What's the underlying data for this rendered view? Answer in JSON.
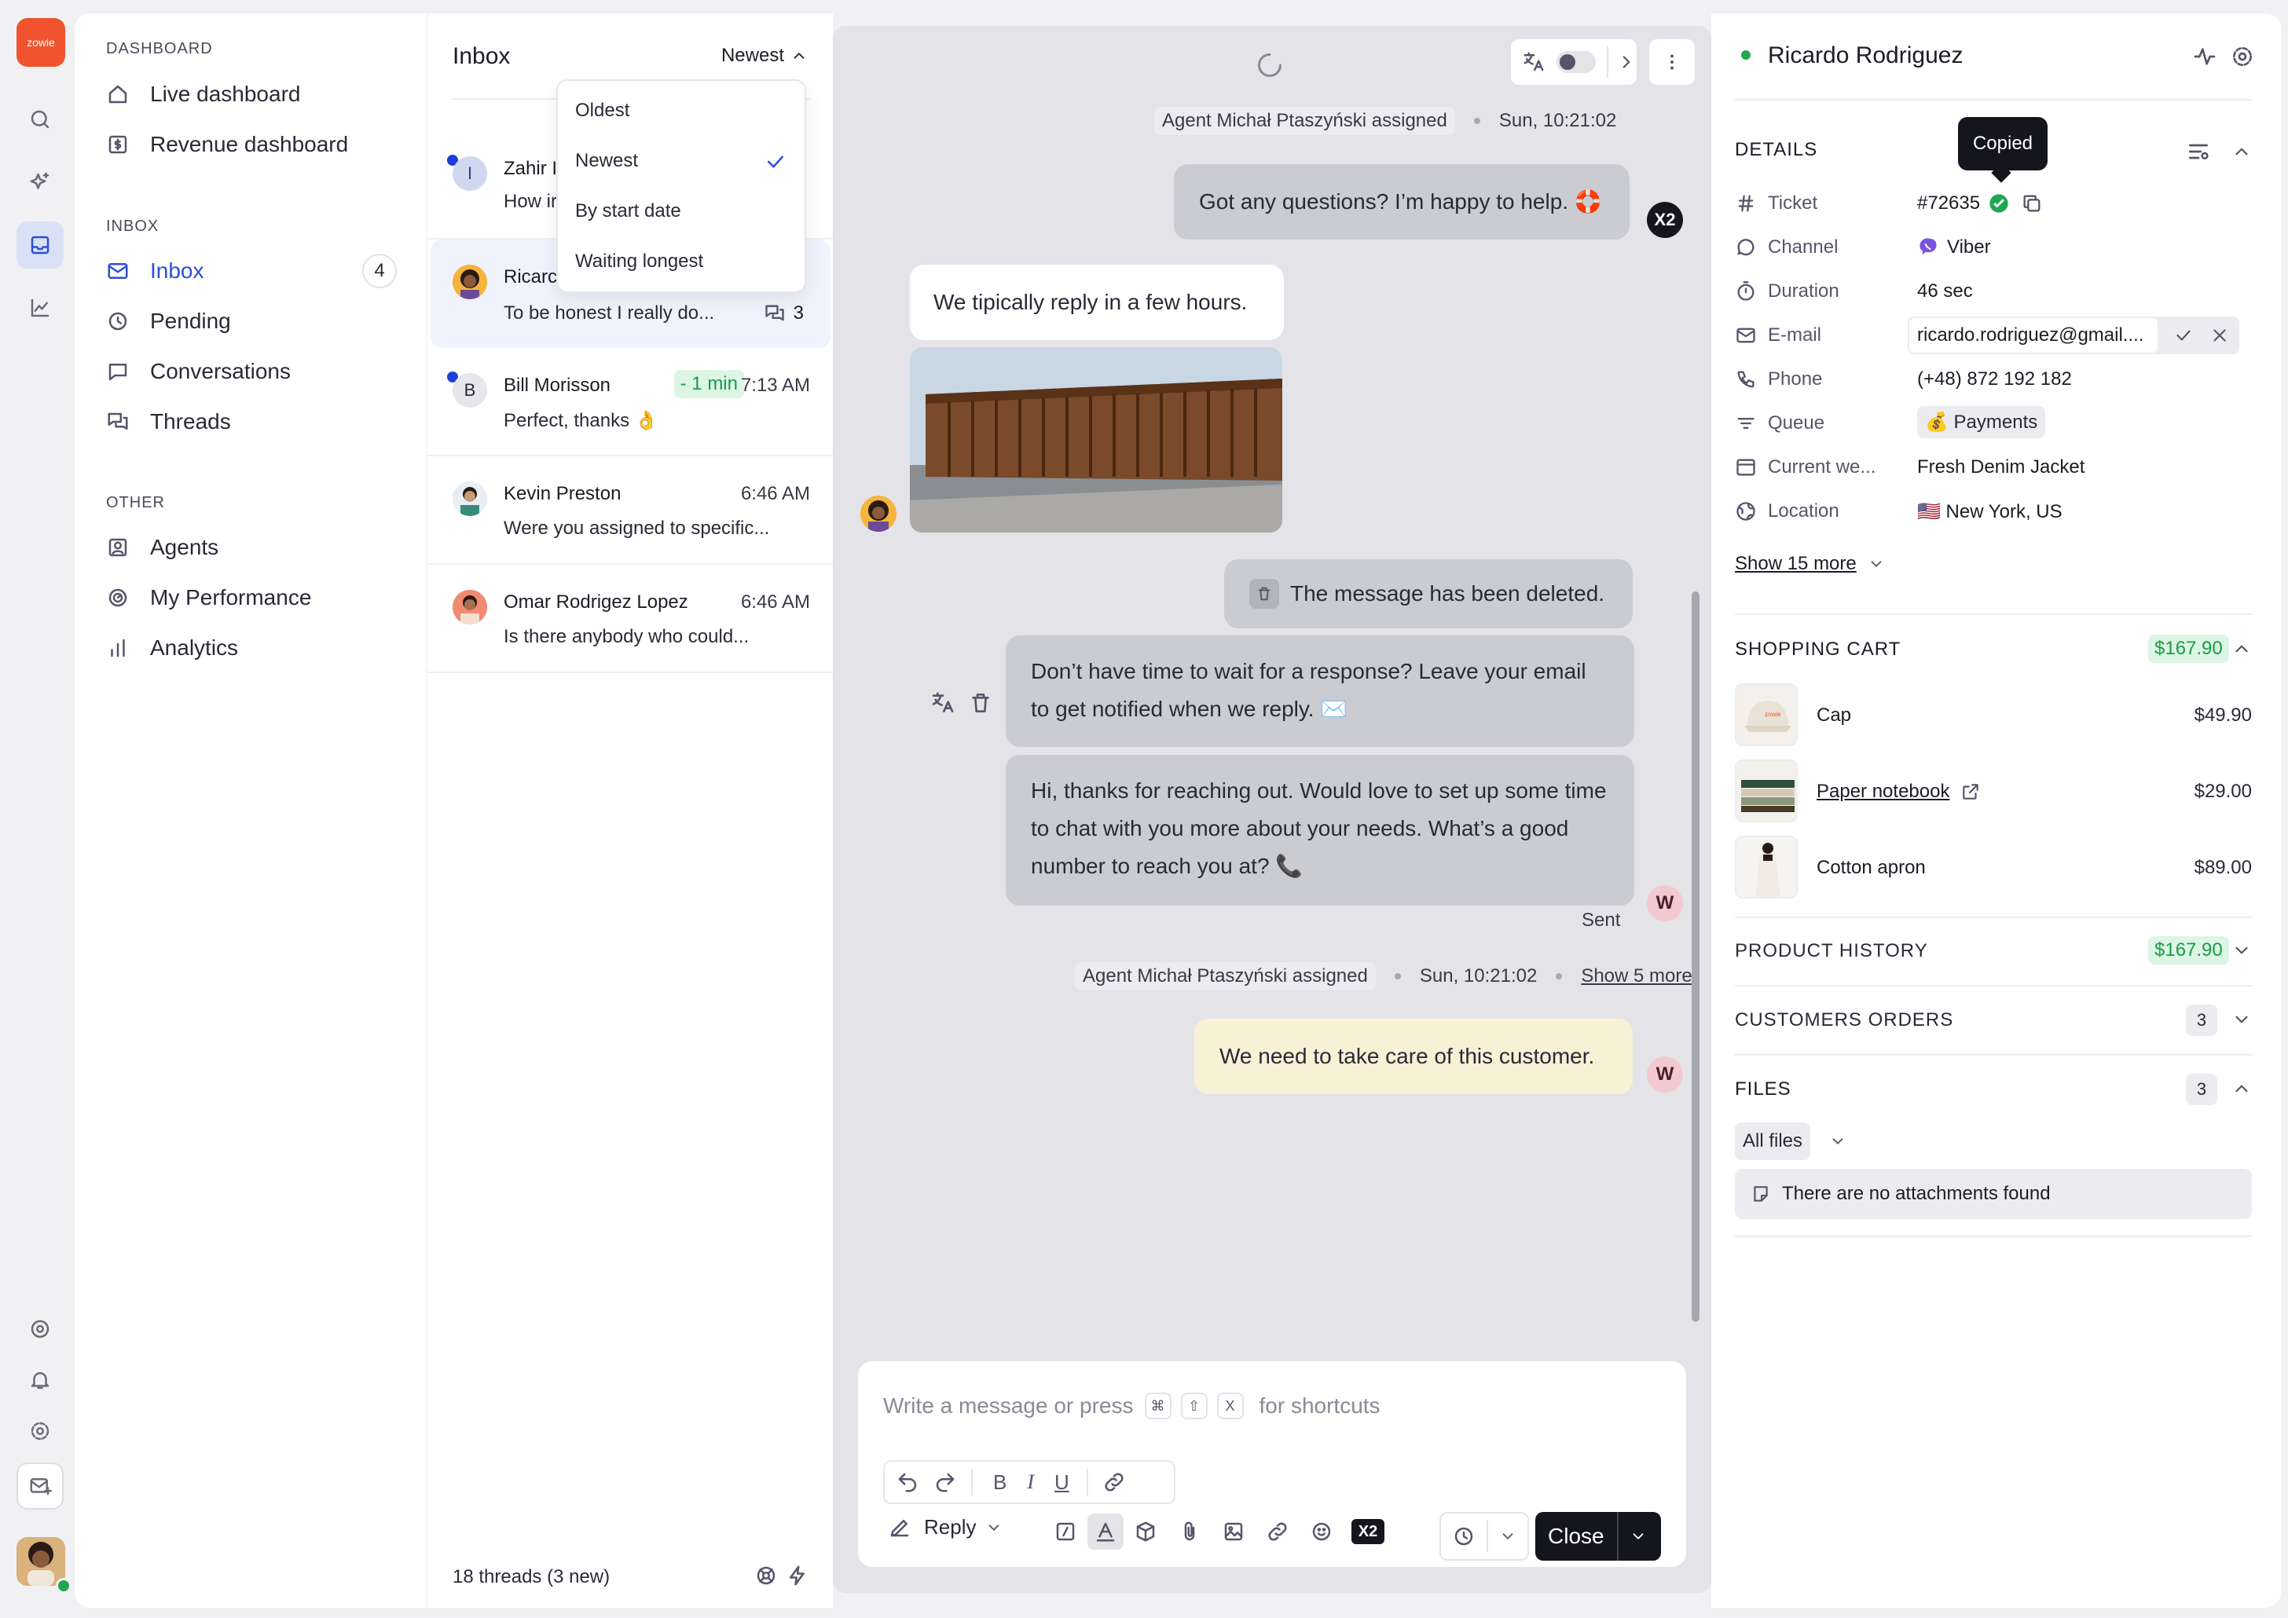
{
  "nav": {
    "logo_text": "zowie",
    "dashboard_section": "DASHBOARD",
    "live_dashboard": "Live dashboard",
    "revenue_dashboard": "Revenue dashboard",
    "inbox_section": "INBOX",
    "inbox": "Inbox",
    "inbox_count": "4",
    "pending": "Pending",
    "conversations": "Conversations",
    "threads": "Threads",
    "other_section": "OTHER",
    "agents": "Agents",
    "my_performance": "My Performance",
    "analytics": "Analytics"
  },
  "inbox_list": {
    "title": "Inbox",
    "sort_label": "Newest",
    "sort_options": [
      "Oldest",
      "Newest",
      "By start date",
      "Waiting longest"
    ],
    "selected_sort": "Newest",
    "conversations": [
      {
        "name": "Zahir I",
        "preview": "How ir",
        "initial": "I",
        "unread": true
      },
      {
        "name": "Ricarc",
        "preview": "To be honest I really do...",
        "thread_count": "3",
        "selected": true
      },
      {
        "name": "Bill Morisson",
        "preview": "Perfect, thanks 👌",
        "time": "7:13 AM",
        "wait": "- 1 min",
        "initial": "B",
        "unread": true
      },
      {
        "name": "Kevin Preston",
        "preview": "Were you assigned to specific...",
        "time": "6:46 AM"
      },
      {
        "name": "Omar Rodrigez Lopez",
        "preview": "Is there anybody who could...",
        "time": "6:46 AM"
      }
    ],
    "footer": "18 threads (3 new)"
  },
  "chat": {
    "assign1_agent": "Agent Michał Ptaszyński assigned",
    "assign1_time": "Sun, 10:21:02",
    "msg_questions": "Got any questions? I’m happy to help. 🛟",
    "msg_reply_time": "We tipically reply in a few hours.",
    "msg_deleted": "The message has been deleted.",
    "msg_email": "Don’t have time to wait for a response? Leave your email to get notified when we reply. ✉️",
    "msg_thanks": "Hi, thanks for reaching out. Would love to set up some time to chat with you more about your needs. What’s a good number to reach you at? 📞",
    "sent_label": "Sent",
    "assign2_agent": "Agent Michał Ptaszyński assigned",
    "assign2_time": "Sun, 10:21:02",
    "show_more": "Show 5 more",
    "note": "We need to take care of this customer.",
    "agent_avatar": "W",
    "bot_badge": "X2"
  },
  "composer": {
    "placeholder_start": "Write a message or press",
    "key1": "⌘",
    "key2": "⇧",
    "key3": "X",
    "placeholder_end": "for shortcuts",
    "reply_label": "Reply",
    "close_label": "Close",
    "x2_label": "X2"
  },
  "customer": {
    "name": "Ricardo Rodriguez",
    "status_color": "#22a652",
    "details_title": "DETAILS",
    "tooltip": "Copied",
    "fields": [
      {
        "label": "Ticket",
        "value": "#72635"
      },
      {
        "label": "Channel",
        "value": "Viber"
      },
      {
        "label": "Duration",
        "value": "46 sec"
      },
      {
        "label": "E-mail",
        "value": "ricardo.rodriguez@gmail...."
      },
      {
        "label": "Phone",
        "value": "(+48) 872 192 182"
      },
      {
        "label": "Queue",
        "value": "💰 Payments"
      },
      {
        "label": "Current we...",
        "value": "Fresh Denim Jacket"
      },
      {
        "label": "Location",
        "value": "🇺🇸 New York, US"
      }
    ],
    "show_more": "Show 15 more",
    "cart_title": "SHOPPING CART",
    "cart_total": "$167.90",
    "cart_items": [
      {
        "name": "Cap",
        "price": "$49.90"
      },
      {
        "name": "Paper notebook",
        "price": "$29.00"
      },
      {
        "name": "Cotton apron",
        "price": "$89.00"
      }
    ],
    "product_history_title": "PRODUCT HISTORY",
    "product_history_total": "$167.90",
    "orders_title": "CUSTOMERS ORDERS",
    "orders_count": "3",
    "files_title": "FILES",
    "files_count": "3",
    "files_filter": "All files",
    "files_empty": "There are no attachments found"
  },
  "colors": {
    "accent": "#2c4fd6",
    "brand": "#f0532d",
    "success": "#22a652",
    "dark": "#15151d"
  }
}
